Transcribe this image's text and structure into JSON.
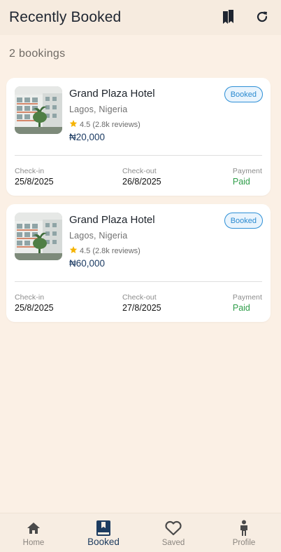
{
  "header": {
    "title": "Recently Booked",
    "icons": [
      "bookmark-icon",
      "refresh-icon"
    ]
  },
  "summary": {
    "count_text": "2 bookings"
  },
  "bookings": [
    {
      "name": "Grand Plaza Hotel",
      "location": "Lagos, Nigeria",
      "rating": "4.5 (2.8k reviews)",
      "price": "₦20,000",
      "status": "Booked",
      "checkin_label": "Check-in",
      "checkin": "25/8/2025",
      "checkout_label": "Check-out",
      "checkout": "26/8/2025",
      "payment_label": "Payment",
      "payment": "Paid"
    },
    {
      "name": "Grand Plaza Hotel",
      "location": "Lagos, Nigeria",
      "rating": "4.5 (2.8k reviews)",
      "price": "₦60,000",
      "status": "Booked",
      "checkin_label": "Check-in",
      "checkin": "25/8/2025",
      "checkout_label": "Check-out",
      "checkout": "27/8/2025",
      "payment_label": "Payment",
      "payment": "Paid"
    }
  ],
  "nav": {
    "home": "Home",
    "booked": "Booked",
    "saved": "Saved",
    "profile": "Profile"
  },
  "colors": {
    "background": "#fbf0e5",
    "accent": "#1d3c60",
    "badge": "#2d8fd6",
    "paid": "#2e9d49",
    "star": "#f5b301"
  }
}
